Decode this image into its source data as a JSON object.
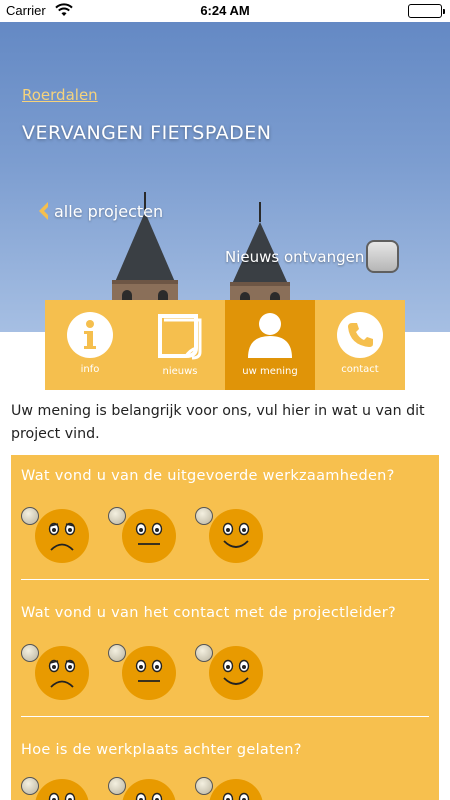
{
  "status": {
    "carrier": "Carrier",
    "time": "6:24 AM",
    "battery_level": 1.0
  },
  "hero": {
    "breadcrumb": "Roerdalen",
    "title": "VERVANGEN FIETSPADEN",
    "back_label": "alle projecten",
    "news_label": "Nieuws ontvangen",
    "news_checked": false
  },
  "tabs": [
    {
      "label": "info",
      "icon": "info-icon",
      "active": false
    },
    {
      "label": "nieuws",
      "icon": "news-icon",
      "active": false
    },
    {
      "label": "uw mening",
      "icon": "person-icon",
      "active": true
    },
    {
      "label": "contact",
      "icon": "phone-icon",
      "active": false
    }
  ],
  "intro": "Uw mening is belangrijk voor ons, vul hier in wat u van dit project vind.",
  "survey": {
    "questions": [
      {
        "text": "Wat vond u van de uitgevoerde werkzaamheden?",
        "options": [
          "sad-face-icon",
          "neutral-face-icon",
          "happy-face-icon"
        ]
      },
      {
        "text": "Wat vond u van het contact met de projectleider?",
        "options": [
          "sad-face-icon",
          "neutral-face-icon",
          "happy-face-icon"
        ]
      },
      {
        "text": "Hoe is de werkplaats achter gelaten?",
        "options": [
          "sad-face-icon",
          "neutral-face-icon",
          "happy-face-icon"
        ]
      }
    ]
  },
  "colors": {
    "accent": "#f5bf4e",
    "accent_dark": "#e09408",
    "face": "#e89a00",
    "sky": "#6f92c8"
  }
}
